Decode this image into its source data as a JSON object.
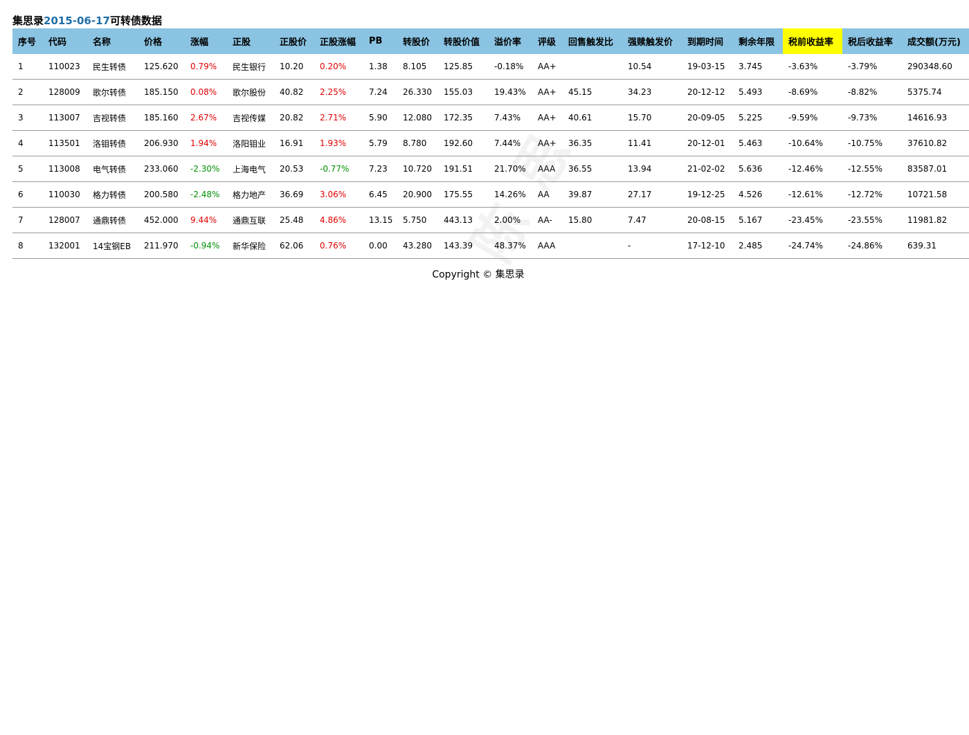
{
  "title": {
    "prefix": "集思录",
    "date": "2015-06-17",
    "suffix": "可转债数据"
  },
  "table": {
    "headers": [
      "序号",
      "代码",
      "名称",
      "价格",
      "涨幅",
      "正股",
      "正股价",
      "正股涨幅",
      "PB",
      "转股价",
      "转股价值",
      "溢价率",
      "评级",
      "回售触发比",
      "强赎触发价",
      "到期时间",
      "剩余年限",
      "税前收益率",
      "税后收益率",
      "成交额(万元)"
    ],
    "rows": [
      [
        "1",
        "110023",
        "民生转债",
        "125.620",
        "0.79%",
        "民生银行",
        "10.20",
        "0.20%",
        "1.38",
        "8.105",
        "125.85",
        "-0.18%",
        "AA+",
        "",
        "10.54",
        "19-03-15",
        "3.745",
        "-3.63%",
        "-3.79%",
        "290348.60"
      ],
      [
        "2",
        "128009",
        "歌尔转债",
        "185.150",
        "0.08%",
        "歌尔股份",
        "40.82",
        "2.25%",
        "7.24",
        "26.330",
        "155.03",
        "19.43%",
        "AA+",
        "45.15",
        "34.23",
        "20-12-12",
        "5.493",
        "-8.69%",
        "-8.82%",
        "5375.74"
      ],
      [
        "3",
        "113007",
        "吉视转债",
        "185.160",
        "2.67%",
        "吉视传媒",
        "20.82",
        "2.71%",
        "5.90",
        "12.080",
        "172.35",
        "7.43%",
        "AA+",
        "40.61",
        "15.70",
        "20-09-05",
        "5.225",
        "-9.59%",
        "-9.73%",
        "14616.93"
      ],
      [
        "4",
        "113501",
        "洛钼转债",
        "206.930",
        "1.94%",
        "洛阳钼业",
        "16.91",
        "1.93%",
        "5.79",
        "8.780",
        "192.60",
        "7.44%",
        "AA+",
        "36.35",
        "11.41",
        "20-12-01",
        "5.463",
        "-10.64%",
        "-10.75%",
        "37610.82"
      ],
      [
        "5",
        "113008",
        "电气转债",
        "233.060",
        "-2.30%",
        "上海电气",
        "20.53",
        "-0.77%",
        "7.23",
        "10.720",
        "191.51",
        "21.70%",
        "AAA",
        "36.55",
        "13.94",
        "21-02-02",
        "5.636",
        "-12.46%",
        "-12.55%",
        "83587.01"
      ],
      [
        "6",
        "110030",
        "格力转债",
        "200.580",
        "-2.48%",
        "格力地产",
        "36.69",
        "3.06%",
        "6.45",
        "20.900",
        "175.55",
        "14.26%",
        "AA",
        "39.87",
        "27.17",
        "19-12-25",
        "4.526",
        "-12.61%",
        "-12.72%",
        "10721.58"
      ],
      [
        "7",
        "128007",
        "通鼎转债",
        "452.000",
        "9.44%",
        "通鼎互联",
        "25.48",
        "4.86%",
        "13.15",
        "5.750",
        "443.13",
        "2.00%",
        "AA-",
        "15.80",
        "7.47",
        "20-08-15",
        "5.167",
        "-23.45%",
        "-23.55%",
        "11981.82"
      ],
      [
        "8",
        "132001",
        "14宝钢EB",
        "211.970",
        "-0.94%",
        "新华保险",
        "62.06",
        "0.76%",
        "0.00",
        "43.280",
        "143.39",
        "48.37%",
        "AAA",
        "",
        "-",
        "17-12-10",
        "2.485",
        "-24.74%",
        "-24.86%",
        "639.31"
      ]
    ]
  },
  "colors": {
    "header_bg": "#8bc4e3",
    "highlight_bg": "#ffff00",
    "up": "#e00000",
    "down": "#009000",
    "date": "#1f6fa6"
  },
  "watermark": "陈思",
  "footer": {
    "copyright": "Copyright © 集思录"
  }
}
